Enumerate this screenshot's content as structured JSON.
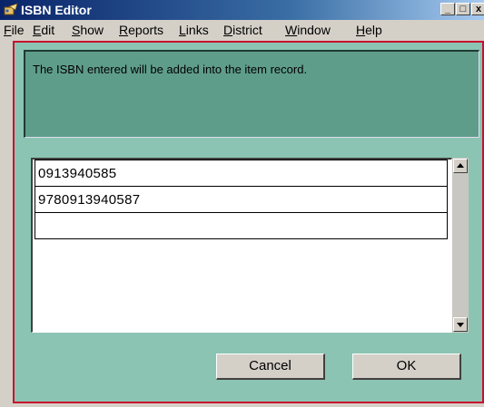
{
  "window": {
    "title": "ISBN Editor",
    "minimize": "_",
    "maximize": "□",
    "close": "x"
  },
  "menu": [
    {
      "mn": "F",
      "rest": "ile"
    },
    {
      "mn": "E",
      "rest": "dit"
    },
    {
      "mn": "S",
      "rest": "how"
    },
    {
      "mn": "R",
      "rest": "eports"
    },
    {
      "mn": "L",
      "rest": "inks"
    },
    {
      "mn": "D",
      "rest": "istrict"
    },
    {
      "mn": "W",
      "rest": "indow"
    },
    {
      "mn": "H",
      "rest": "elp"
    }
  ],
  "message": "The ISBN entered will be added into the item record.",
  "isbns": [
    "0913940585",
    "9780913940587",
    ""
  ],
  "buttons": {
    "cancel": "Cancel",
    "ok": "OK"
  },
  "colors": {
    "client_bg": "#8bc4b2",
    "message_bg": "#5f9d8b",
    "frame_border": "#c8102e"
  }
}
